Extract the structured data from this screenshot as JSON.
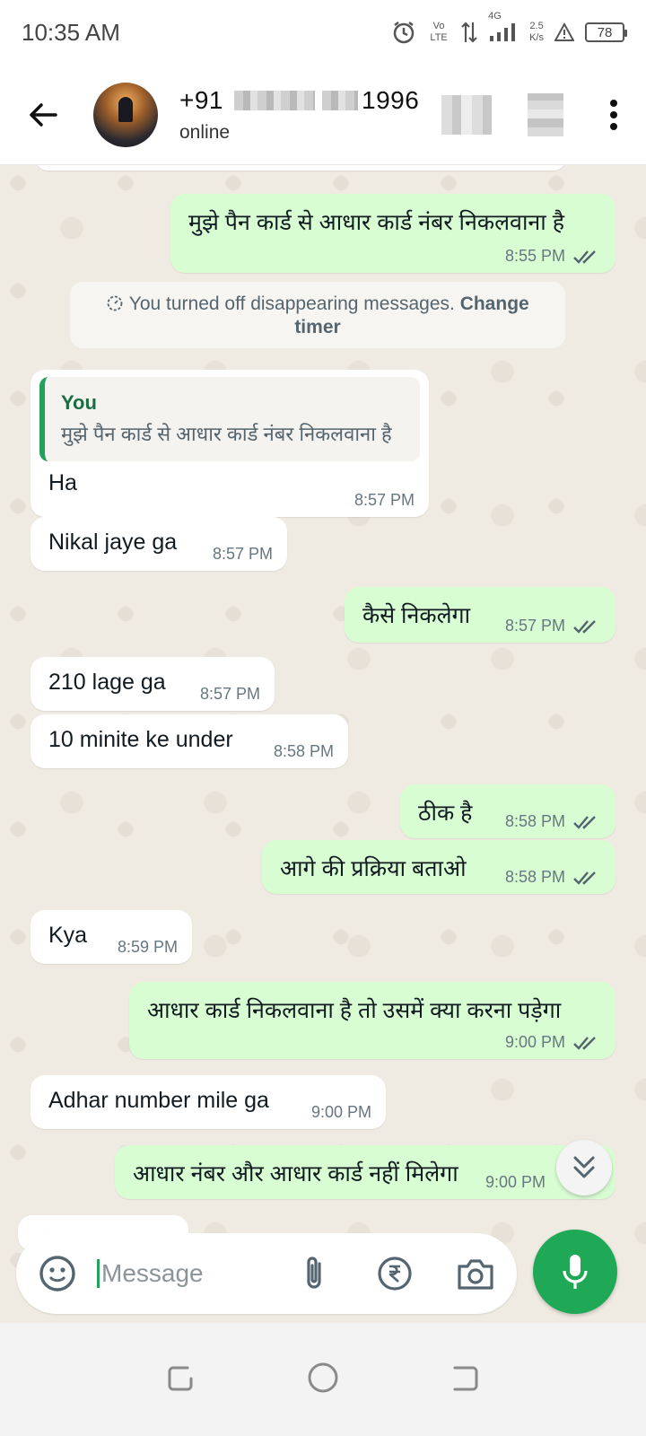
{
  "status_bar": {
    "time": "10:35 AM",
    "network": "Vo LTE",
    "signal": "4G",
    "speed_value": "2.5",
    "speed_unit": "K/s",
    "battery": "78"
  },
  "header": {
    "phone_prefix": "+91",
    "phone_suffix": "1996",
    "status": "online"
  },
  "system_message": {
    "text": "You turned off disappearing messages. ",
    "action": "Change timer"
  },
  "messages": [
    {
      "dir": "out",
      "text": "मुझे पैन कार्ड से आधार कार्ड नंबर निकलवाना है",
      "time": "8:55 PM"
    },
    {
      "dir": "in",
      "quote_author": "You",
      "quote_text": "मुझे पैन कार्ड से आधार कार्ड नंबर निकलवाना है",
      "text": "Ha",
      "time": "8:57 PM"
    },
    {
      "dir": "in",
      "text": "Nikal jaye ga",
      "time": "8:57 PM"
    },
    {
      "dir": "out",
      "text": "कैसे निकलेगा",
      "time": "8:57 PM"
    },
    {
      "dir": "in",
      "text": "210 lage ga",
      "time": "8:57 PM"
    },
    {
      "dir": "in",
      "text": "10 minite ke under",
      "time": "8:58 PM"
    },
    {
      "dir": "out",
      "text": "ठीक है",
      "time": "8:58 PM"
    },
    {
      "dir": "out",
      "text": "आगे की प्रक्रिया बताओ",
      "time": "8:58 PM"
    },
    {
      "dir": "in",
      "text": "Kya",
      "time": "8:59 PM"
    },
    {
      "dir": "out",
      "text": "आधार कार्ड निकलवाना है तो उसमें क्या करना पड़ेगा",
      "time": "9:00 PM"
    },
    {
      "dir": "in",
      "text": "Adhar number mile ga",
      "time": "9:00 PM"
    },
    {
      "dir": "out",
      "text": "आधार नंबर और आधार कार्ड नहीं मिलेगा",
      "time": "9:00 PM"
    }
  ],
  "composer": {
    "placeholder": "Message"
  },
  "colors": {
    "outgoing": "#d9fdd3",
    "incoming": "#ffffff",
    "accent": "#1fa855"
  }
}
